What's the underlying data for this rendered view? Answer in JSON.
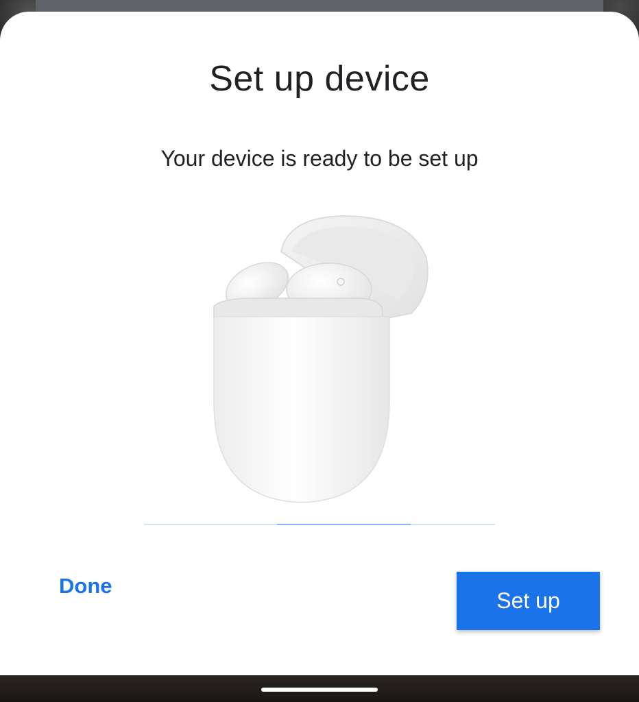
{
  "dialog": {
    "title": "Set up device",
    "subtitle": "Your device is ready to be set up"
  },
  "illustration": {
    "icon": "earbuds-case-icon",
    "description_visible": false
  },
  "progress": {
    "value": 0.5,
    "track_color": "#d2e3fc",
    "fill_color": "#8ab4f8"
  },
  "actions": {
    "done_label": "Done",
    "setup_label": "Set up"
  },
  "colors": {
    "accent": "#1a73e8",
    "text": "#202124",
    "sheet": "#ffffff"
  }
}
